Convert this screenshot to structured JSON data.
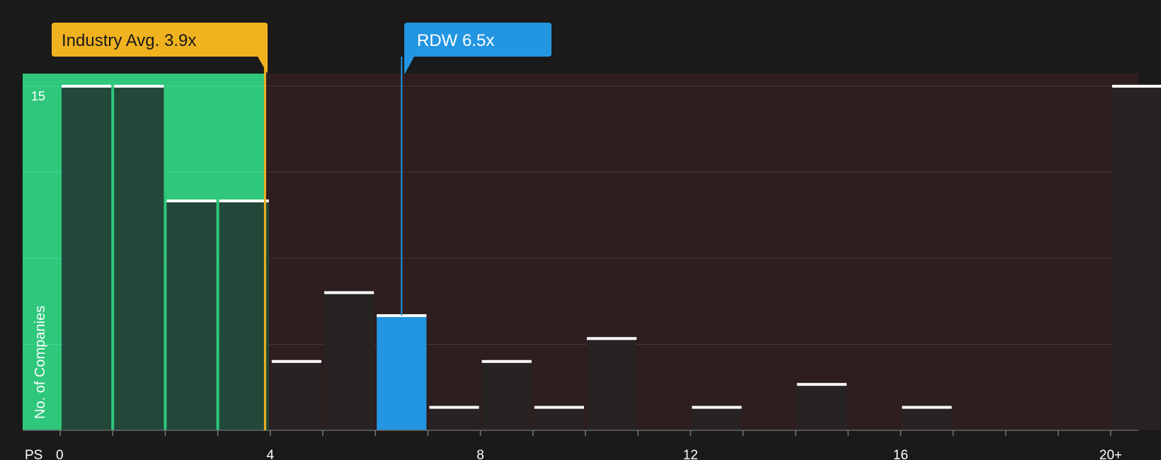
{
  "chart_data": {
    "type": "bar",
    "x_axis_label": "PS",
    "y_axis_label": "No. of Companies",
    "x_ticks": [
      "0",
      "4",
      "8",
      "12",
      "16",
      "20+"
    ],
    "y_ticks": [
      15
    ],
    "ylim": [
      0,
      15.55
    ],
    "bins": [
      {
        "x0": 0,
        "x1": 1,
        "count": 15
      },
      {
        "x0": 1,
        "x1": 2,
        "count": 15
      },
      {
        "x0": 2,
        "x1": 3,
        "count": 10
      },
      {
        "x0": 3,
        "x1": 4,
        "count": 10
      },
      {
        "x0": 4,
        "x1": 5,
        "count": 3
      },
      {
        "x0": 5,
        "x1": 6,
        "count": 6
      },
      {
        "x0": 6,
        "x1": 7,
        "count": 5,
        "highlight": true
      },
      {
        "x0": 7,
        "x1": 8,
        "count": 1
      },
      {
        "x0": 8,
        "x1": 9,
        "count": 3
      },
      {
        "x0": 9,
        "x1": 10,
        "count": 1
      },
      {
        "x0": 10,
        "x1": 11,
        "count": 4
      },
      {
        "x0": 12,
        "x1": 13,
        "count": 1
      },
      {
        "x0": 14,
        "x1": 15,
        "count": 2
      },
      {
        "x0": 16,
        "x1": 17,
        "count": 1
      },
      {
        "x0": 20,
        "x1": 21,
        "count": 15,
        "label": "20+"
      }
    ],
    "industry_avg": {
      "label": "Industry Avg. 3.9x",
      "value": 3.9
    },
    "company": {
      "label": "RDW 6.5x",
      "value": 6.5
    },
    "colors": {
      "background": "#1a1a1a",
      "below_avg_zone": "#2ec77b",
      "above_avg_zone": "#2e1e1f",
      "bar": "#272323",
      "bar_in_green": "#22483a",
      "highlight_bar": "#2396e2",
      "industry_callout": "#f0b21f",
      "company_callout": "#2396e2",
      "bar_cap": "#ffffff"
    }
  }
}
